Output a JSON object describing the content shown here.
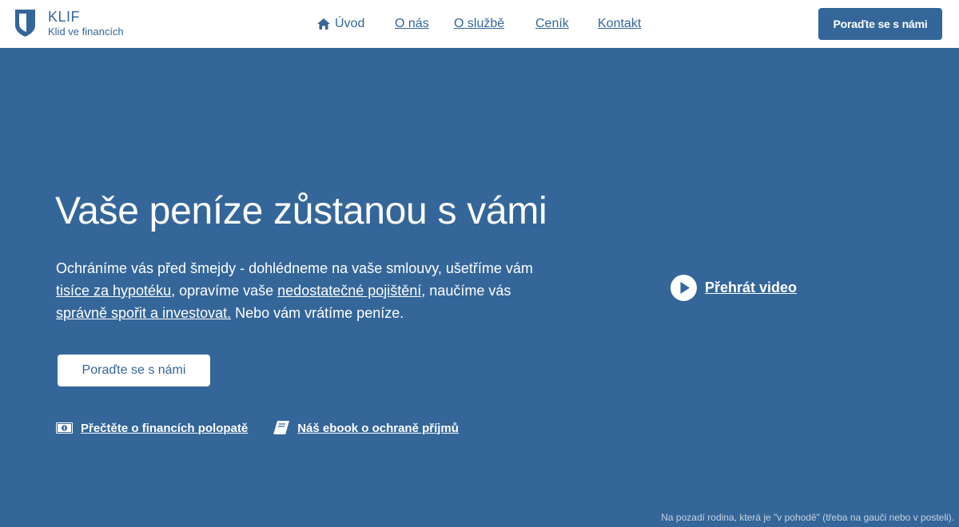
{
  "brand": {
    "name": "KLIF",
    "tagline": "Klid ve financích",
    "primary_color": "#346699",
    "logo_icon": "shield-icon"
  },
  "nav": {
    "home": {
      "label": "Úvod",
      "icon": "home-icon"
    },
    "about": "O nás",
    "service": "O službě",
    "pricing": "Ceník",
    "contact": "Kontakt"
  },
  "header": {
    "cta_label": "Poraďte se s námi"
  },
  "hero": {
    "headline": "Vaše peníze zůstanou s vámi",
    "lead": {
      "part1": "Ochráníme vás před šmejdy - dohlédneme na vaše smlouvy, ušetříme vám ",
      "link1": "tisíce za hypotéku",
      "part2": ", opravíme vaše ",
      "link2": "nedostatečné pojištění",
      "part3": ", naučíme vás ",
      "link3": "správně spořit a investovat.",
      "part4": " Nebo vám vrátíme peníze."
    },
    "cta_label": "Poraďte se s námi",
    "video": {
      "label": "Přehrát video",
      "icon": "play-icon"
    },
    "links": [
      {
        "label": "Přečtěte o financích polopatě",
        "icon": "money-icon"
      },
      {
        "label": "Náš ebook o ochraně příjmů",
        "icon": "book-icon"
      }
    ]
  },
  "background_caption": "Na pozadí rodina, která je \"v pohodě\" (třeba na gauči nebo v posteli)."
}
